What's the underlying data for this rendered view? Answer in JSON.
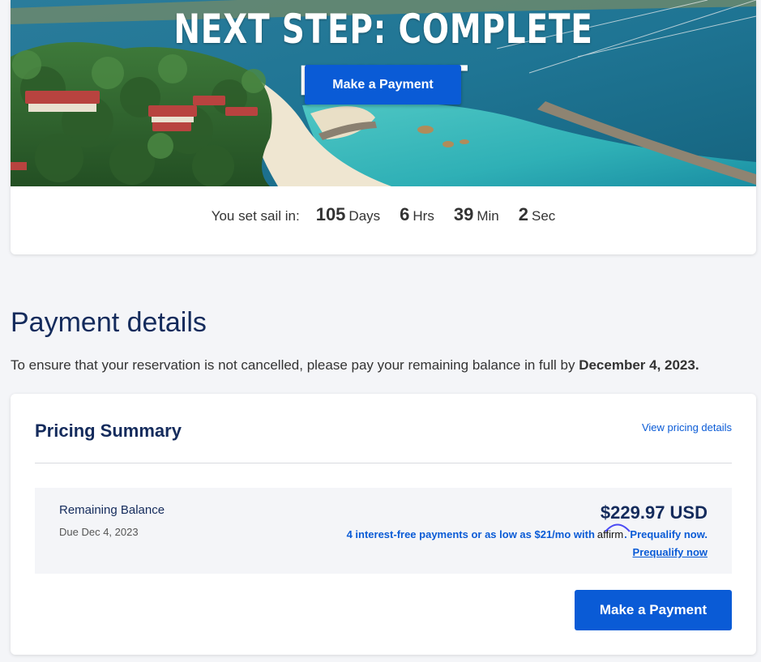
{
  "hero": {
    "title": "NEXT STEP: COMPLETE PAYMENT",
    "button_label": "Make a Payment"
  },
  "countdown": {
    "label": "You set sail in:",
    "days_value": "105",
    "days_unit": "Days",
    "hours_value": "6",
    "hours_unit": "Hrs",
    "minutes_value": "39",
    "minutes_unit": "Min",
    "seconds_value": "2",
    "seconds_unit": "Sec"
  },
  "payment_details": {
    "title": "Payment details",
    "note_prefix": "To ensure that your reservation is not cancelled, please pay your remaining balance in full by",
    "note_date": "December 4, 2023."
  },
  "pricing_summary": {
    "title": "Pricing Summary",
    "details_link": "View pricing details",
    "balance_label": "Remaining Balance",
    "due_date": "Due Dec 4, 2023",
    "amount": "$229.97 USD",
    "affirm_prefix": "4 interest-free payments or as low as $21/mo with",
    "affirm_brand": "affirm",
    "affirm_suffix": ". Prequalify now.",
    "prequalify_link": "Prequalify now",
    "button_label": "Make a Payment"
  },
  "colors": {
    "primary_button": "#0a5bd6",
    "heading_navy": "#142b5c",
    "page_background": "#f4f5f8"
  }
}
